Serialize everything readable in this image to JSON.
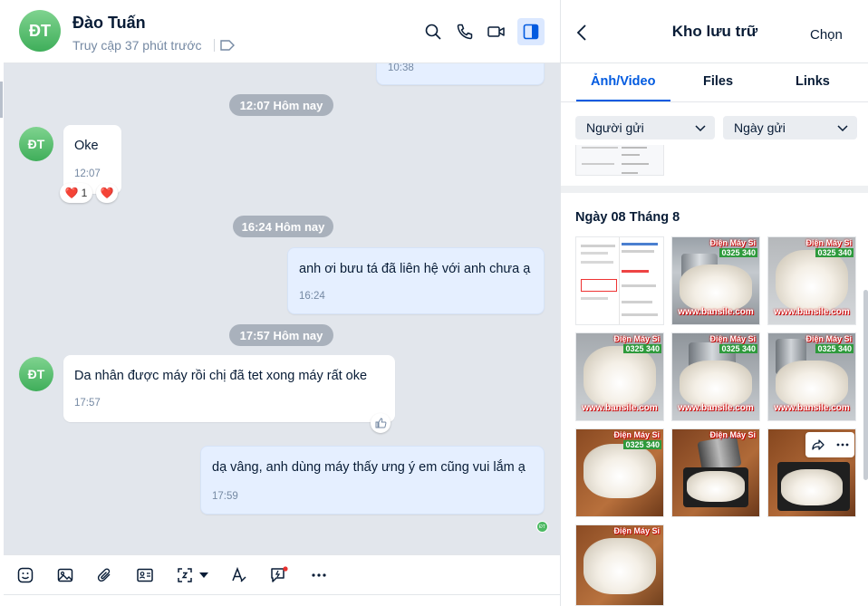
{
  "header": {
    "avatar_initials": "ĐT",
    "name": "Đào Tuấn",
    "status": "Truy cập 37 phút trước",
    "icons": [
      "tag-icon",
      "search-icon",
      "phone-icon",
      "video-call-icon",
      "side-panel-icon"
    ]
  },
  "messages": {
    "partial_top_time": "10:38",
    "dividers": [
      "12:07 Hôm nay",
      "16:24 Hôm nay",
      "17:57 Hôm nay"
    ],
    "items": [
      {
        "side": "in",
        "avatar": "ĐT",
        "text": "Oke",
        "time": "12:07",
        "reactions": [
          {
            "emoji": "❤️",
            "count": "1"
          },
          {
            "emoji": "❤️",
            "count": ""
          }
        ]
      },
      {
        "side": "out",
        "text": "anh ơi bưu tá đã liên hệ với anh chưa ạ",
        "time": "16:24"
      },
      {
        "side": "in",
        "avatar": "ĐT",
        "text": "Da nhân được máy rồi chị đã tet xong máy  rất oke",
        "time": "17:57"
      },
      {
        "side": "out",
        "text": "dạ vâng, anh dùng máy thấy ưng ý em cũng vui lắm ạ",
        "time": "17:59"
      }
    ],
    "seen_avatar": "ĐT"
  },
  "toolbar": {
    "icons": [
      "sticker-icon",
      "image-icon",
      "attachment-icon",
      "contact-card-icon",
      "screenshot-icon",
      "dropdown-arrow-icon",
      "text-format-icon",
      "quick-message-icon",
      "more-icon"
    ]
  },
  "panel": {
    "title": "Kho lưu trữ",
    "select_label": "Chọn",
    "tabs": [
      "Ảnh/Video",
      "Files",
      "Links"
    ],
    "active_tab": "Ảnh/Video",
    "filters": [
      "Người gửi",
      "Ngày gửi"
    ],
    "date_heading": "Ngày 08 Tháng 8",
    "watermark_brand": "Điện Máy Sỉ",
    "watermark_phone": "0325 340",
    "watermark_site": "www.bansile.com",
    "accent": "#005ae0"
  }
}
